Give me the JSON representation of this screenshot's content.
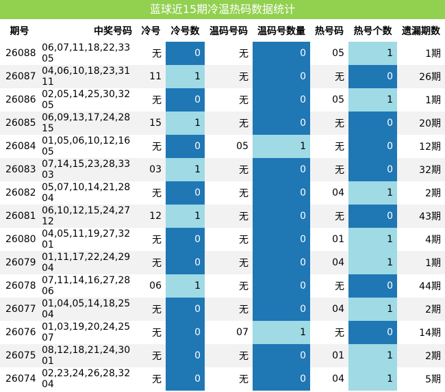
{
  "title": "蓝球近15期冷温热码数据统计",
  "headers": [
    "期号",
    "中奖号码",
    "冷号",
    "冷号数",
    "温码号码",
    "温码号数量",
    "热号码",
    "热号个数",
    "遗漏期数"
  ],
  "colors": {
    "title_bg": "#92d050",
    "dark": "#1f77b4",
    "light": "#9fdae5",
    "stripe": "#f2f2f2"
  },
  "rows": [
    {
      "issue": "26088",
      "numbers": "06,07,11,18,22,33",
      "blue": "05",
      "cold": "无",
      "cold_count": "0",
      "warm": "无",
      "warm_count": "0",
      "hot": "05",
      "hot_count": "1",
      "miss": "1期"
    },
    {
      "issue": "26087",
      "numbers": "04,06,10,18,23,31",
      "blue": "11",
      "cold": "11",
      "cold_count": "1",
      "warm": "无",
      "warm_count": "0",
      "hot": "无",
      "hot_count": "0",
      "miss": "26期"
    },
    {
      "issue": "26086",
      "numbers": "02,05,14,25,30,32",
      "blue": "05",
      "cold": "无",
      "cold_count": "0",
      "warm": "无",
      "warm_count": "0",
      "hot": "05",
      "hot_count": "1",
      "miss": "1期"
    },
    {
      "issue": "26085",
      "numbers": "06,09,13,17,24,28",
      "blue": "15",
      "cold": "15",
      "cold_count": "1",
      "warm": "无",
      "warm_count": "0",
      "hot": "无",
      "hot_count": "0",
      "miss": "20期"
    },
    {
      "issue": "26084",
      "numbers": "01,05,06,10,12,16",
      "blue": "05",
      "cold": "无",
      "cold_count": "0",
      "warm": "05",
      "warm_count": "1",
      "hot": "无",
      "hot_count": "0",
      "miss": "12期"
    },
    {
      "issue": "26083",
      "numbers": "07,14,15,23,28,33",
      "blue": "03",
      "cold": "03",
      "cold_count": "1",
      "warm": "无",
      "warm_count": "0",
      "hot": "无",
      "hot_count": "0",
      "miss": "32期"
    },
    {
      "issue": "26082",
      "numbers": "05,07,10,14,21,28",
      "blue": "04",
      "cold": "无",
      "cold_count": "0",
      "warm": "无",
      "warm_count": "0",
      "hot": "04",
      "hot_count": "1",
      "miss": "2期"
    },
    {
      "issue": "26081",
      "numbers": "06,10,12,15,24,27",
      "blue": "12",
      "cold": "12",
      "cold_count": "1",
      "warm": "无",
      "warm_count": "0",
      "hot": "无",
      "hot_count": "0",
      "miss": "43期"
    },
    {
      "issue": "26080",
      "numbers": "04,05,11,19,27,32",
      "blue": "01",
      "cold": "无",
      "cold_count": "0",
      "warm": "无",
      "warm_count": "0",
      "hot": "01",
      "hot_count": "1",
      "miss": "4期"
    },
    {
      "issue": "26079",
      "numbers": "01,11,17,22,24,29",
      "blue": "04",
      "cold": "无",
      "cold_count": "0",
      "warm": "无",
      "warm_count": "0",
      "hot": "04",
      "hot_count": "1",
      "miss": "1期"
    },
    {
      "issue": "26078",
      "numbers": "07,11,14,16,27,28",
      "blue": "06",
      "cold": "06",
      "cold_count": "1",
      "warm": "无",
      "warm_count": "0",
      "hot": "无",
      "hot_count": "0",
      "miss": "44期"
    },
    {
      "issue": "26077",
      "numbers": "01,04,05,14,18,25",
      "blue": "04",
      "cold": "无",
      "cold_count": "0",
      "warm": "无",
      "warm_count": "0",
      "hot": "04",
      "hot_count": "1",
      "miss": "2期"
    },
    {
      "issue": "26076",
      "numbers": "01,03,19,20,24,25",
      "blue": "07",
      "cold": "无",
      "cold_count": "0",
      "warm": "07",
      "warm_count": "1",
      "hot": "无",
      "hot_count": "0",
      "miss": "14期"
    },
    {
      "issue": "26075",
      "numbers": "08,12,18,21,24,30",
      "blue": "01",
      "cold": "无",
      "cold_count": "0",
      "warm": "无",
      "warm_count": "0",
      "hot": "01",
      "hot_count": "1",
      "miss": "2期"
    },
    {
      "issue": "26074",
      "numbers": "02,23,24,26,28,32",
      "blue": "04",
      "cold": "无",
      "cold_count": "0",
      "warm": "无",
      "warm_count": "0",
      "hot": "04",
      "hot_count": "1",
      "miss": "5期"
    }
  ]
}
